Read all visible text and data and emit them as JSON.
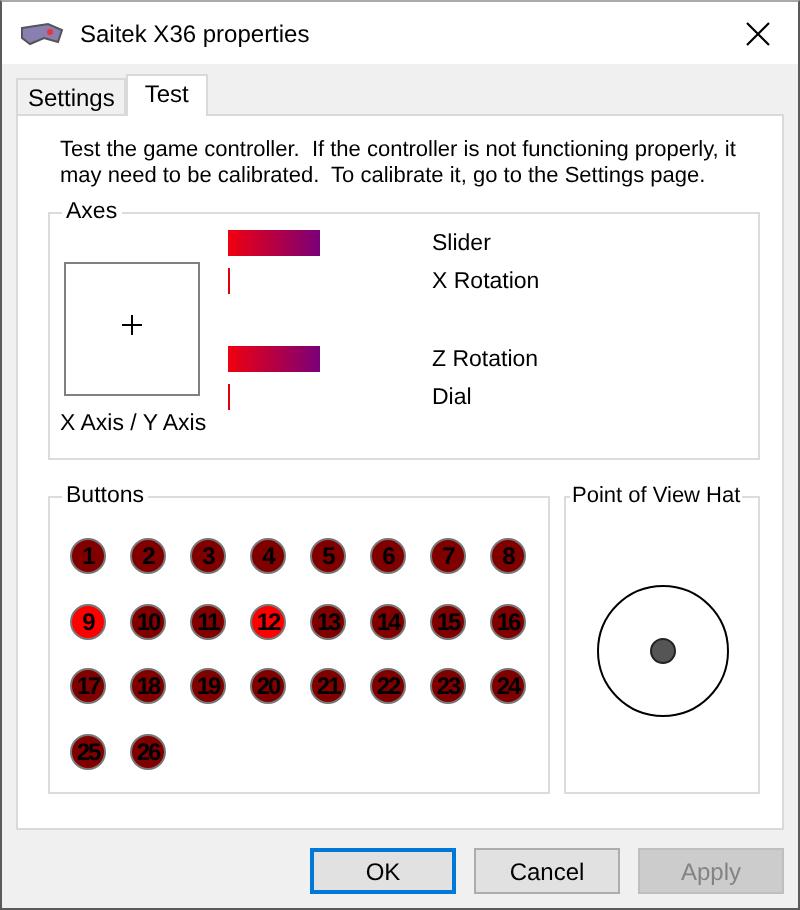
{
  "window": {
    "title": "Saitek X36 properties"
  },
  "tabs": [
    {
      "label": "Settings",
      "selected": false
    },
    {
      "label": "Test",
      "selected": true
    }
  ],
  "description": "Test the game controller.  If the controller is not functioning properly, it may need to be calibrated.  To calibrate it, go to the Settings page.",
  "axes": {
    "title": "Axes",
    "xy_label": "X Axis / Y Axis",
    "bars": [
      {
        "label": "Slider",
        "kind": "bar"
      },
      {
        "label": "X Rotation",
        "kind": "line"
      },
      {
        "label": "Z Rotation",
        "kind": "bar"
      },
      {
        "label": "Dial",
        "kind": "line"
      }
    ]
  },
  "buttons_group": {
    "title": "Buttons",
    "buttons": [
      {
        "label": "1",
        "pressed": false
      },
      {
        "label": "2",
        "pressed": false
      },
      {
        "label": "3",
        "pressed": false
      },
      {
        "label": "4",
        "pressed": false
      },
      {
        "label": "5",
        "pressed": false
      },
      {
        "label": "6",
        "pressed": false
      },
      {
        "label": "7",
        "pressed": false
      },
      {
        "label": "8",
        "pressed": false
      },
      {
        "label": "9",
        "pressed": true
      },
      {
        "label": "10",
        "pressed": false
      },
      {
        "label": "11",
        "pressed": false
      },
      {
        "label": "12",
        "pressed": true
      },
      {
        "label": "13",
        "pressed": false
      },
      {
        "label": "14",
        "pressed": false
      },
      {
        "label": "15",
        "pressed": false
      },
      {
        "label": "16",
        "pressed": false
      },
      {
        "label": "17",
        "pressed": false
      },
      {
        "label": "18",
        "pressed": false
      },
      {
        "label": "19",
        "pressed": false
      },
      {
        "label": "20",
        "pressed": false
      },
      {
        "label": "21",
        "pressed": false
      },
      {
        "label": "22",
        "pressed": false
      },
      {
        "label": "23",
        "pressed": false
      },
      {
        "label": "24",
        "pressed": false
      },
      {
        "label": "25",
        "pressed": false
      },
      {
        "label": "26",
        "pressed": false
      }
    ]
  },
  "pov_hat": {
    "title": "Point of View Hat"
  },
  "dialog_buttons": [
    {
      "label": "OK",
      "kind": "default",
      "disabled": false
    },
    {
      "label": "Cancel",
      "kind": "normal",
      "disabled": false
    },
    {
      "label": "Apply",
      "kind": "normal",
      "disabled": true
    }
  ]
}
